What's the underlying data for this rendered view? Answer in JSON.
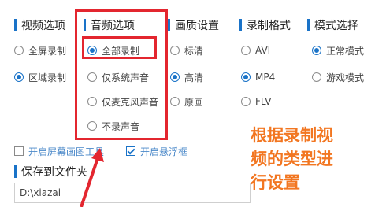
{
  "sections": {
    "video": {
      "title": "视频选项",
      "options": [
        {
          "label": "全屏录制",
          "checked": false
        },
        {
          "label": "区域录制",
          "checked": true
        }
      ]
    },
    "audio": {
      "title": "音频选项",
      "options": [
        {
          "label": "全部录制",
          "checked": true
        },
        {
          "label": "仅系统声音",
          "checked": false
        },
        {
          "label": "仅麦克风声音",
          "checked": false
        },
        {
          "label": "不录声音",
          "checked": false
        }
      ]
    },
    "quality": {
      "title": "画质设置",
      "options": [
        {
          "label": "标清",
          "checked": false
        },
        {
          "label": "高清",
          "checked": true
        },
        {
          "label": "原画",
          "checked": false
        }
      ]
    },
    "format": {
      "title": "录制格式",
      "options": [
        {
          "label": "AVI",
          "checked": false
        },
        {
          "label": "MP4",
          "checked": true
        },
        {
          "label": "FLV",
          "checked": false
        }
      ]
    },
    "mode": {
      "title": "模式选择",
      "options": [
        {
          "label": "正常模式",
          "checked": true
        },
        {
          "label": "游戏模式",
          "checked": false
        }
      ]
    }
  },
  "checkboxes": {
    "brush_tool": {
      "label": "开启屏幕画图工具",
      "checked": false
    },
    "float_window": {
      "label": "开启悬浮框",
      "checked": true
    }
  },
  "save": {
    "title": "保存到文件夹",
    "path": "D:\\xiazai"
  },
  "annotation": {
    "lines": [
      "根据录制视",
      "频的类型进",
      "行设置"
    ]
  },
  "colors": {
    "accent": "#1a73c8",
    "highlight_box": "#e3262f",
    "annotation_text": "#f27621"
  }
}
